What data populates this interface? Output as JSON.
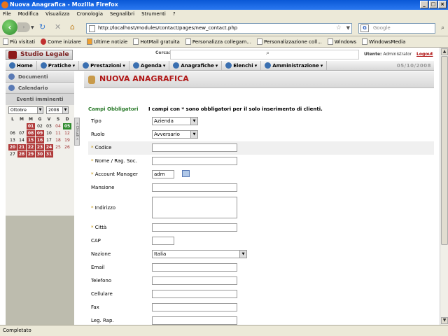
{
  "window": {
    "title": "Nuova Anagrafica - Mozilla Firefox"
  },
  "menu": [
    "File",
    "Modifica",
    "Visualizza",
    "Cronologia",
    "Segnalibri",
    "Strumenti",
    "?"
  ],
  "nav": {
    "url": "http://localhost/modules/contact/pages/new_contact.php",
    "search_placeholder": "Google"
  },
  "bookmarks": [
    "Più visitati",
    "Come iniziare",
    "Ultime notizie",
    "HotMail gratuita",
    "Personalizza collegam...",
    "Personalizzazione coll...",
    "Windows",
    "WindowsMedia"
  ],
  "status": "Completato",
  "app": {
    "logo": "Studio Legale",
    "search_label": "Cerca:",
    "user_label": "Utente:",
    "user_name": "Administrator",
    "logout": "Logout",
    "date": "05/10/2008",
    "nav": [
      "Home",
      "Pratiche",
      "Prestazioni",
      "Agenda",
      "Anagrafiche",
      "Elenchi",
      "Amministrazione"
    ]
  },
  "sidebar": {
    "items": [
      "Documenti",
      "Calendario"
    ],
    "events_title": "Eventi imminenti",
    "tab": "« Chiudi «",
    "calendar": {
      "month": "Ottobre",
      "year": "2008",
      "day_headers": [
        "L",
        "M",
        "M",
        "G",
        "V",
        "S",
        "D"
      ],
      "weeks": [
        [
          "",
          "",
          "01",
          "02",
          "03",
          "04",
          "05"
        ],
        [
          "06",
          "07",
          "08",
          "09",
          "10",
          "11",
          "12"
        ],
        [
          "13",
          "14",
          "15",
          "16",
          "17",
          "18",
          "19"
        ],
        [
          "20",
          "21",
          "22",
          "23",
          "24",
          "25",
          "26"
        ],
        [
          "27",
          "28",
          "29",
          "30",
          "31",
          "",
          ""
        ]
      ],
      "event_days": [
        "01",
        "08",
        "09",
        "15",
        "16",
        "20",
        "21",
        "22",
        "23",
        "24",
        "28",
        "29",
        "30",
        "31"
      ],
      "today": "05"
    }
  },
  "page": {
    "title": "NUOVA ANAGRAFICA",
    "required_label": "Campi Obbligatori",
    "required_note": "I campi con * sono obbligatori per il solo inserimento di clienti.",
    "fields": {
      "tipo": {
        "label": "Tipo",
        "value": "Azienda"
      },
      "ruolo": {
        "label": "Ruolo",
        "value": "Avversario"
      },
      "codice": {
        "label": "Codice",
        "value": ""
      },
      "nome": {
        "label": "Nome / Rag. Soc.",
        "value": ""
      },
      "account": {
        "label": "Account Manager",
        "value": "adm"
      },
      "mansione": {
        "label": "Mansione",
        "value": ""
      },
      "indirizzo": {
        "label": "Indirizzo",
        "value": ""
      },
      "citta": {
        "label": "Città",
        "value": ""
      },
      "cap": {
        "label": "CAP",
        "value": ""
      },
      "nazione": {
        "label": "Nazione",
        "value": "Italia"
      },
      "email": {
        "label": "Email",
        "value": ""
      },
      "telefono": {
        "label": "Telefono",
        "value": ""
      },
      "cellulare": {
        "label": "Cellulare",
        "value": ""
      },
      "fax": {
        "label": "Fax",
        "value": ""
      },
      "legrap": {
        "label": "Leg. Rap.",
        "value": ""
      }
    }
  }
}
